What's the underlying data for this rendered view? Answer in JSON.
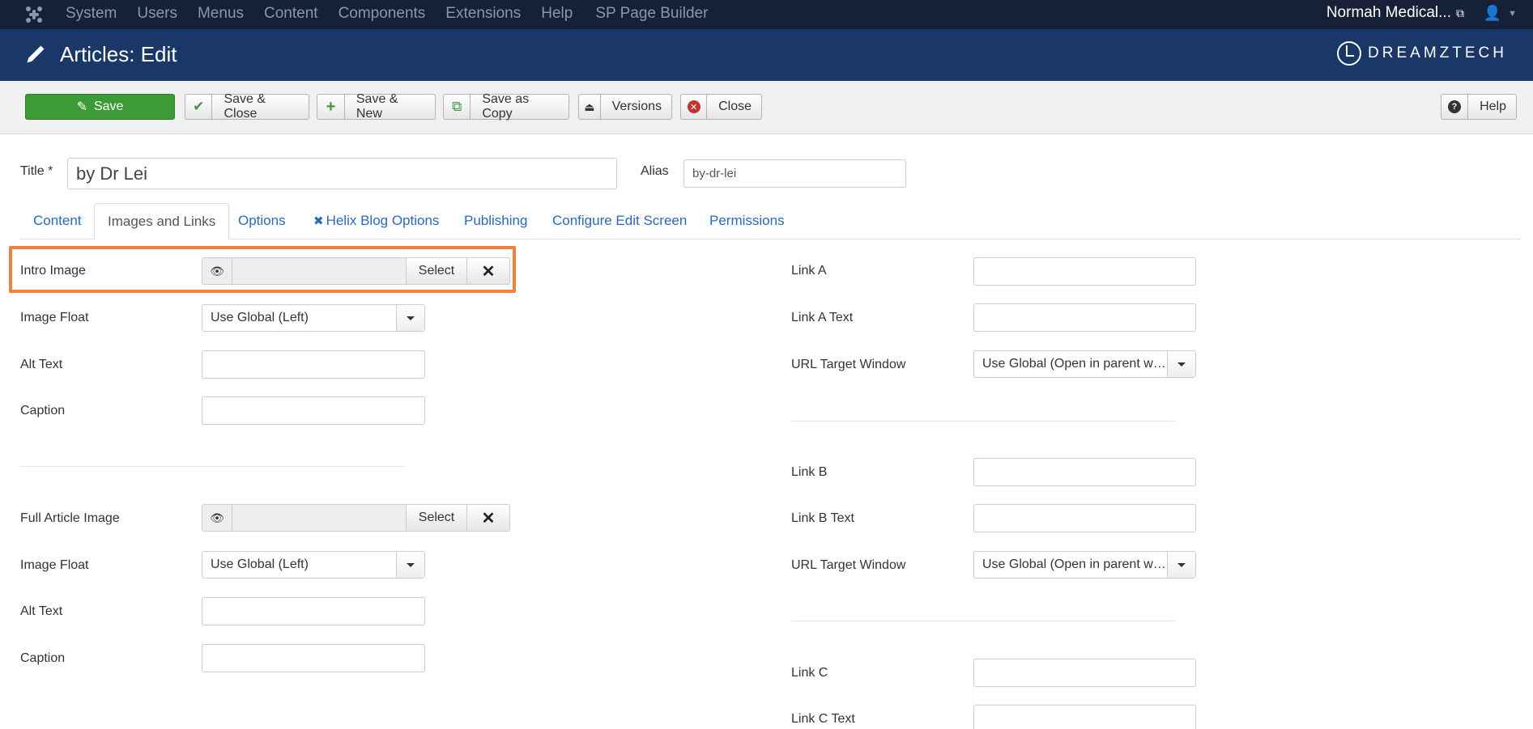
{
  "topnav": {
    "menu": [
      "System",
      "Users",
      "Menus",
      "Content",
      "Components",
      "Extensions",
      "Help",
      "SP Page Builder"
    ],
    "site": "Normah Medical...",
    "icons": [
      "joomla-icon",
      "external-link-icon",
      "user-icon"
    ]
  },
  "header": {
    "title": "Articles: Edit",
    "brand": "DREAMZTECH",
    "color": "#1a3867"
  },
  "toolbar": {
    "save": "Save",
    "save_close": "Save & Close",
    "save_new": "Save & New",
    "save_copy": "Save as Copy",
    "versions": "Versions",
    "close": "Close",
    "help": "Help"
  },
  "form": {
    "title_label": "Title *",
    "title_value": "by Dr Lei",
    "alias_label": "Alias",
    "alias_value": "by-dr-lei"
  },
  "tabs": [
    "Content",
    "Images and Links",
    "Options",
    "Helix Blog Options",
    "Publishing",
    "Configure Edit Screen",
    "Permissions"
  ],
  "active_tab": "Images and Links",
  "images": {
    "intro_image_label": "Intro Image",
    "select_label": "Select",
    "image_float_label": "Image Float",
    "image_float_value": "Use Global (Left)",
    "alt_text_label": "Alt Text",
    "caption_label": "Caption",
    "full_image_label": "Full Article Image"
  },
  "links": {
    "link_a": "Link A",
    "link_a_text": "Link A Text",
    "url_target": "URL Target Window",
    "url_target_value": "Use Global (Open in parent w…",
    "link_b": "Link B",
    "link_b_text": "Link B Text",
    "link_c": "Link C",
    "link_c_text": "Link C Text"
  },
  "highlight_color": "#f0803c"
}
